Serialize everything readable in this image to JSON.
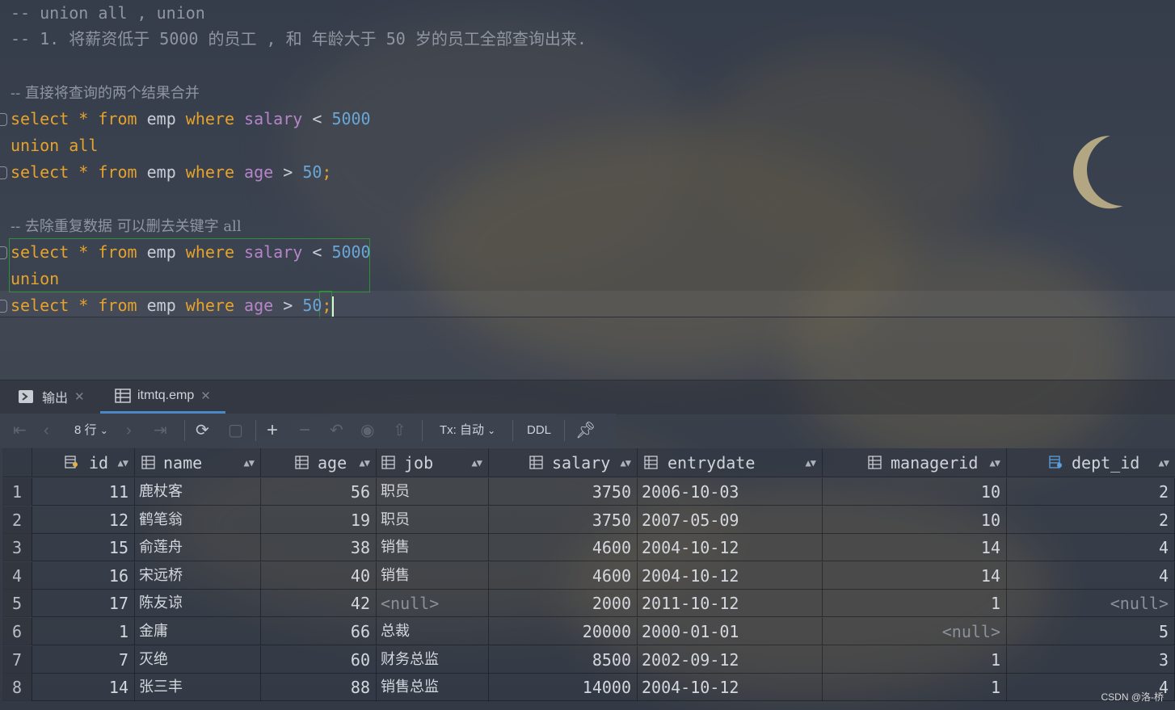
{
  "editor": {
    "lines": [
      {
        "type": "comment",
        "text": "-- union all , union"
      },
      {
        "type": "comment",
        "text": "-- 1. 将薪资低于 5000 的员工 , 和 年龄大于 50 岁的员工全部查询出来."
      },
      {
        "type": "comment",
        "text": "-- 直接将查询的两个结果合并"
      },
      {
        "type": "comment",
        "text": "-- 去除重复数据 可以删去关键字 all"
      }
    ],
    "kw_select": "select",
    "kw_from": "from",
    "kw_where": "where",
    "kw_union_all": "union all",
    "kw_union": "union",
    "star": "*",
    "table": "emp",
    "col_salary": "salary",
    "col_age": "age",
    "op_lt": "<",
    "op_gt": ">",
    "num_5000": "5000",
    "num_50": "50",
    "semicolon": ";"
  },
  "tabs": [
    {
      "label": "输出",
      "icon": "console-icon"
    },
    {
      "label": "itmtq.emp",
      "icon": "table-icon"
    }
  ],
  "toolbar": {
    "row_count": "8 行",
    "tx_label": "Tx: 自动",
    "ddl_label": "DDL"
  },
  "table": {
    "columns": [
      "id",
      "name",
      "age",
      "job",
      "salary",
      "entrydate",
      "managerid",
      "dept_id"
    ],
    "rows": [
      {
        "n": "1",
        "id": "11",
        "name": "鹿杖客",
        "age": "56",
        "job": "职员",
        "salary": "3750",
        "entrydate": "2006-10-03",
        "managerid": "10",
        "dept_id": "2"
      },
      {
        "n": "2",
        "id": "12",
        "name": "鹤笔翁",
        "age": "19",
        "job": "职员",
        "salary": "3750",
        "entrydate": "2007-05-09",
        "managerid": "10",
        "dept_id": "2"
      },
      {
        "n": "3",
        "id": "15",
        "name": "俞莲舟",
        "age": "38",
        "job": "销售",
        "salary": "4600",
        "entrydate": "2004-10-12",
        "managerid": "14",
        "dept_id": "4"
      },
      {
        "n": "4",
        "id": "16",
        "name": "宋远桥",
        "age": "40",
        "job": "销售",
        "salary": "4600",
        "entrydate": "2004-10-12",
        "managerid": "14",
        "dept_id": "4"
      },
      {
        "n": "5",
        "id": "17",
        "name": "陈友谅",
        "age": "42",
        "job": "<null>",
        "salary": "2000",
        "entrydate": "2011-10-12",
        "managerid": "1",
        "dept_id": "<null>"
      },
      {
        "n": "6",
        "id": "1",
        "name": "金庸",
        "age": "66",
        "job": "总裁",
        "salary": "20000",
        "entrydate": "2000-01-01",
        "managerid": "<null>",
        "dept_id": "5"
      },
      {
        "n": "7",
        "id": "7",
        "name": "灭绝",
        "age": "60",
        "job": "财务总监",
        "salary": "8500",
        "entrydate": "2002-09-12",
        "managerid": "1",
        "dept_id": "3"
      },
      {
        "n": "8",
        "id": "14",
        "name": "张三丰",
        "age": "88",
        "job": "销售总监",
        "salary": "14000",
        "entrydate": "2004-10-12",
        "managerid": "1",
        "dept_id": "4"
      }
    ]
  },
  "watermark": "CSDN @洛-桥"
}
